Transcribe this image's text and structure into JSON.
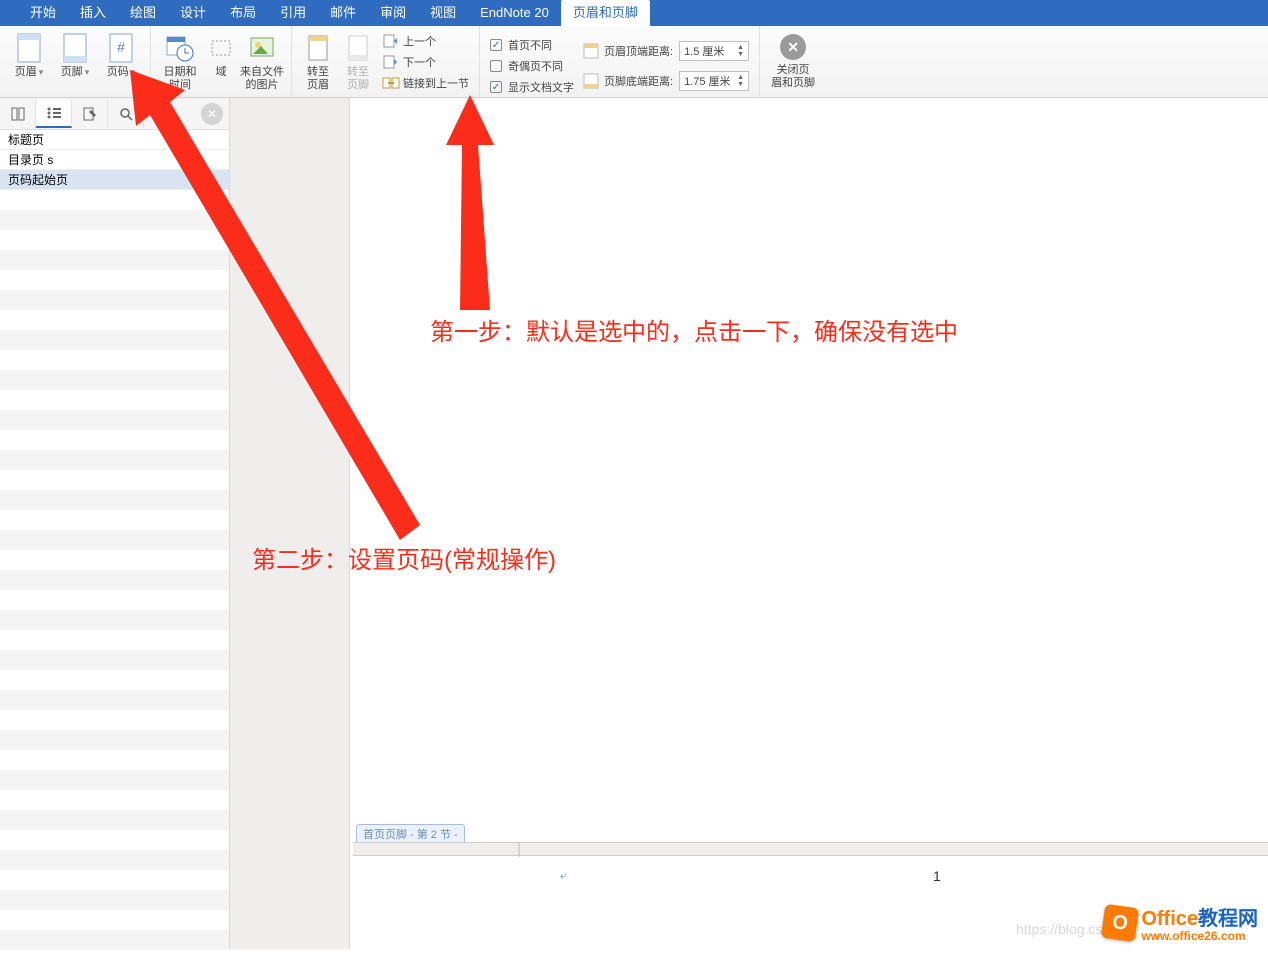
{
  "menu": {
    "tabs": [
      "开始",
      "插入",
      "绘图",
      "设计",
      "布局",
      "引用",
      "邮件",
      "审阅",
      "视图",
      "EndNote 20",
      "页眉和页脚"
    ],
    "active_index": 10
  },
  "ribbon": {
    "g1": {
      "header": "页眉",
      "footer": "页脚",
      "pagenum": "页码"
    },
    "g2": {
      "datetime": "日期和\n时间",
      "field": "域",
      "picture": "来自文件\n的图片"
    },
    "g3": {
      "gotoHeader": "转至\n页眉",
      "gotoFooter": "转至\n页脚",
      "prev": "上一个",
      "next": "下一个",
      "link": "链接到上一节"
    },
    "g4": {
      "diffFirst": "首页不同",
      "diffOddEven": "奇偶页不同",
      "showDoc": "显示文档文字",
      "headerDistLabel": "页眉顶端距离:",
      "headerDistVal": "1.5 厘米",
      "footerDistLabel": "页脚底端距离:",
      "footerDistVal": "1.75 厘米"
    },
    "close": "关闭页\n眉和页脚"
  },
  "nav": {
    "items": [
      "标题页",
      "目录页 s",
      "页码起始页"
    ],
    "selected_index": 2
  },
  "doc": {
    "footerTag": "首页页脚 - 第 2 节 -",
    "pageNumber": "1"
  },
  "annotations": {
    "step1": "第一步：默认是选中的，点击一下，确保没有选中",
    "step2": "第二步：设置页码(常规操作)"
  },
  "watermark": "https://blog.csdn",
  "brand": {
    "line1a": "Office",
    "line1b": "教程网",
    "line2": "www.office26.com"
  }
}
